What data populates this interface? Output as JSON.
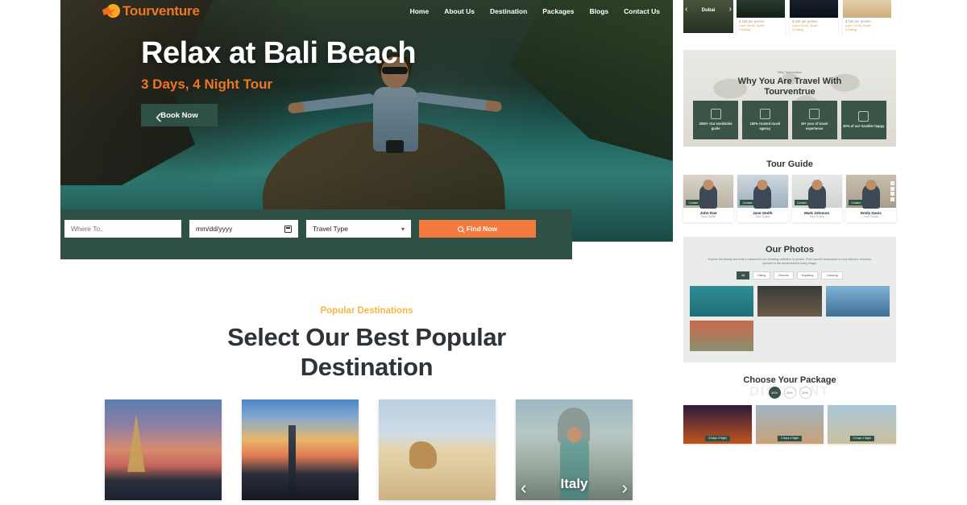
{
  "brand": {
    "name": "Tourventure",
    "accent_orange": "#ef7722",
    "accent_green": "#2f5044",
    "accent_yellow": "#f5b544",
    "button_orange": "#f47b3f"
  },
  "nav": {
    "items": [
      "Home",
      "About Us",
      "Destination",
      "Packages",
      "Blogs",
      "Contact Us"
    ]
  },
  "hero": {
    "title": "Relax at Bali Beach",
    "subtitle": "3 Days, 4 Night Tour",
    "cta": "Book Now",
    "prev": "‹",
    "next": "›"
  },
  "search": {
    "where_placeholder": "Where To..",
    "date_value": "mm/dd/yyyy",
    "type_value": "Travel Type",
    "button": "Find Now"
  },
  "popular": {
    "eyebrow": "Popular Destinations",
    "title": "Select Our Best Popular Destination",
    "cards": [
      {
        "label": ""
      },
      {
        "label": ""
      },
      {
        "label": ""
      },
      {
        "label": "Italy"
      }
    ],
    "prev": "‹",
    "next": "›"
  },
  "preview": {
    "top_cards": {
      "featured_label": "Dubai",
      "prev": "‹",
      "next": "›",
      "items": [
        {
          "price": "$ 160",
          "price_unit": "per person",
          "location": "Lake Gerda, Spain",
          "rating": "5 Rating"
        },
        {
          "price": "$ 160",
          "price_unit": "per person",
          "location": "Lake Gerda, Spain",
          "rating": "5 Rating"
        },
        {
          "price": "$ 160",
          "price_unit": "per person",
          "location": "Lake Gerda, Spain",
          "rating": "5 Rating"
        }
      ]
    },
    "why": {
      "eyebrow": "Why Tourventrue",
      "title": "Why You Are Travel With Tourventrue",
      "features": [
        {
          "text": "2000+ Our worldwide guide"
        },
        {
          "text": "100% trusted travel agency"
        },
        {
          "text": "10+ year of travel experience"
        },
        {
          "text": "90% of our traveller happy"
        }
      ]
    },
    "guide": {
      "title": "Tour Guide",
      "badge": "Contact",
      "members": [
        {
          "name": "John Doe",
          "role": "Tour Guide"
        },
        {
          "name": "Jane Smith",
          "role": "Tour Guide"
        },
        {
          "name": "Mark Johnson",
          "role": "Tour Guide"
        },
        {
          "name": "Emily Davis",
          "role": "Tour Guide"
        }
      ]
    },
    "photos": {
      "title": "Our Photos",
      "description": "Explore the beauty and charm captured in our amazing collection of photos. From sacred landscapes to cozy interiors, immerse yourself in the stories behind every image.",
      "tabs": [
        "All",
        "Hiking",
        "Resorts",
        "Kayaking",
        "Camping"
      ],
      "active_tab": "All"
    },
    "package": {
      "title": "Choose Your Package",
      "ghost_text": "DISCOUNT",
      "pills": [
        "40%",
        "30%",
        "20%"
      ],
      "active_pill": "40%",
      "badge": "3 Days 4 Night",
      "items": [
        {
          "badge": "3 Days 4 Night"
        },
        {
          "badge": "3 Days 4 Night"
        },
        {
          "badge": "3 Days 4 Night"
        }
      ]
    }
  }
}
